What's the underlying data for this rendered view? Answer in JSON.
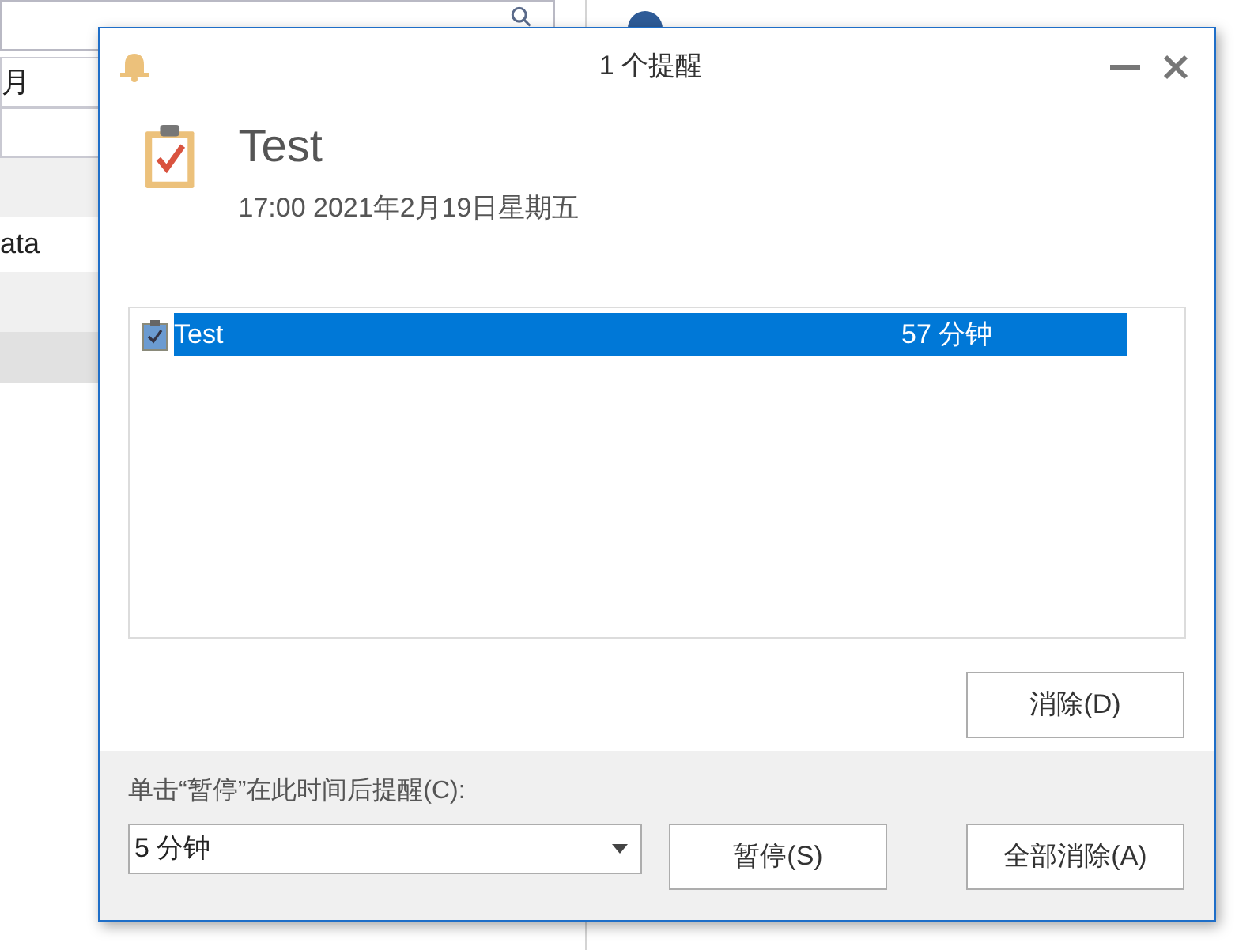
{
  "background": {
    "field_text": "月",
    "row_text": "ata"
  },
  "window": {
    "title": "1 个提醒"
  },
  "reminder": {
    "subject": "Test",
    "time": "17:00 2021年2月19日星期五"
  },
  "list": [
    {
      "subject": "Test",
      "due": "57 分钟",
      "selected": true
    }
  ],
  "dismiss_button": "消除(D)",
  "snooze": {
    "label": "单击“暂停”在此时间后提醒(C):",
    "value": "5 分钟",
    "button": "暂停(S)"
  },
  "dismiss_all_button": "全部消除(A)"
}
